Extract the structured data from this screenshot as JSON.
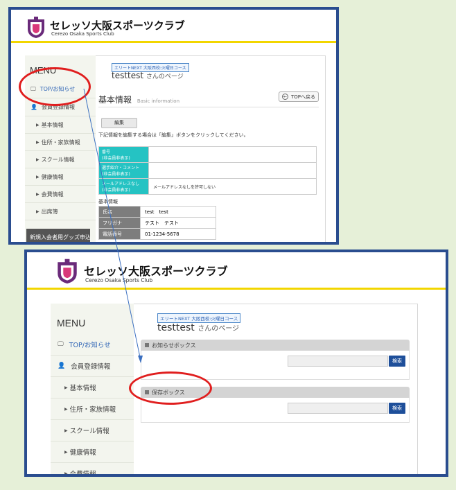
{
  "brand": {
    "name_jp": "セレッソ大阪スポーツクラブ",
    "name_en": "Cerezo Osaka Sports Club",
    "logo_icon": "crest-icon"
  },
  "menu": {
    "title": "MENU",
    "items": [
      {
        "label": "TOP/お知らせ",
        "icon": "monitor-icon"
      },
      {
        "label": "会員登録情報",
        "icon": "person-icon"
      },
      {
        "label": "基本情報",
        "icon": "triangle-right-icon"
      },
      {
        "label": "住所・家族情報",
        "icon": "triangle-right-icon"
      },
      {
        "label": "スクール情報",
        "icon": "triangle-right-icon"
      },
      {
        "label": "健康情報",
        "icon": "triangle-right-icon"
      },
      {
        "label": "会費情報",
        "icon": "triangle-right-icon"
      },
      {
        "label": "出席簿",
        "icon": "triangle-right-icon"
      }
    ],
    "new_member_goods": "新規入会者用グッズ申込"
  },
  "user": {
    "course_tag": "エリートNEXT 大阪西校:火曜日コース",
    "name": "testtest",
    "suffix": "さんのページ"
  },
  "basic_info": {
    "title": "基本情報",
    "title_en": "Basic information",
    "back_label": "TOPへ戻る",
    "edit_label": "編集",
    "note": "下記情報を編集する場合は「編集」ボタンをクリックしてください。",
    "top_table": [
      {
        "label": "番号\n(非会員非表示)",
        "value": ""
      },
      {
        "label": "選手紹介・コメント\n(非会員非表示)",
        "value": ""
      },
      {
        "label": "メールアドレスなし\n(非会員非表示)",
        "value": "メールアドレスなしを許可しない"
      }
    ],
    "section2_label": "基本情報",
    "detail_table": [
      {
        "label": "氏名",
        "value": "test　test"
      },
      {
        "label": "フリガナ",
        "value": "テスト　テスト"
      },
      {
        "label": "電話番号",
        "value": "01-1234-5678"
      }
    ]
  },
  "boxes": {
    "notice_title": "お知らせボックス",
    "save_title": "保存ボックス",
    "search_label": "検索"
  },
  "colors": {
    "frame": "#2a4d8f",
    "accent_yellow": "#f2d600",
    "teal": "#25c3c3",
    "highlight_red": "#e01e1e",
    "button_blue": "#1e4f9a"
  }
}
